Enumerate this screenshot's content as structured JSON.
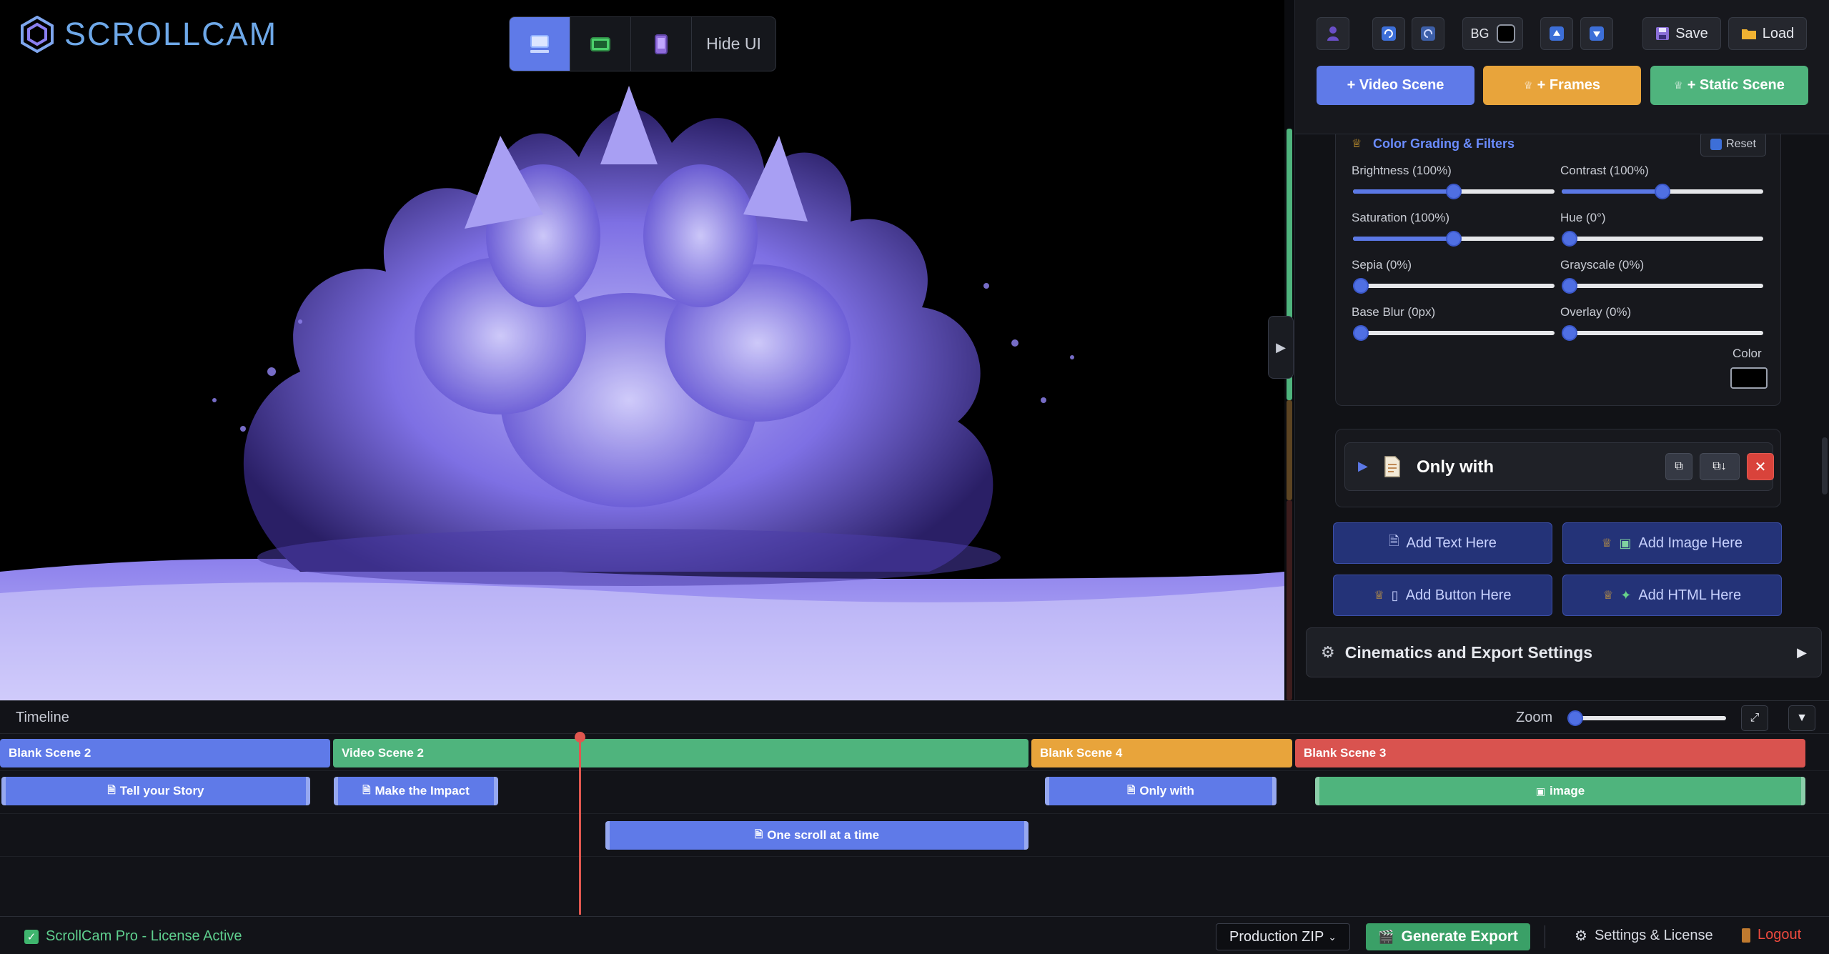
{
  "app": {
    "logo_text": "SCROLLCAM",
    "logo_color": "#6ea8e8"
  },
  "device_bar": {
    "devices": [
      {
        "name": "desktop",
        "icon": "monitor-icon",
        "active": true
      },
      {
        "name": "tablet",
        "icon": "tablet-landscape-icon",
        "active": false
      },
      {
        "name": "mobile",
        "icon": "mobile-phone-icon",
        "active": false
      }
    ],
    "hide_ui_label": "Hide UI"
  },
  "toolbar": {
    "bg_label": "BG",
    "bg_color": "#000000",
    "save_label": "Save",
    "load_label": "Load",
    "icons": [
      "user-silhouette-icon",
      "redo-icon",
      "undo-icon",
      "move-up-icon",
      "move-down-icon",
      "floppy-disk-icon",
      "folder-icon"
    ]
  },
  "scene_buttons": {
    "video": "+ Video Scene",
    "frames": "+ Frames",
    "static": "+ Static Scene",
    "colors": {
      "video": "#5f7ae8",
      "frames": "#e8a43b",
      "static": "#4fb47d"
    }
  },
  "color_grading": {
    "title": "Color Grading & Filters",
    "reset_label": "Reset",
    "sliders": [
      {
        "label": "Brightness (100%)",
        "value": 0.5
      },
      {
        "label": "Contrast (100%)",
        "value": 0.5
      },
      {
        "label": "Saturation (100%)",
        "value": 0.5
      },
      {
        "label": "Hue (0°)",
        "value": 0
      },
      {
        "label": "Sepia (0%)",
        "value": 0
      },
      {
        "label": "Grayscale (0%)",
        "value": 0
      },
      {
        "label": "Base Blur (0px)",
        "value": 0
      },
      {
        "label": "Overlay (0%)",
        "value": 0
      }
    ],
    "color_label": "Color",
    "overlay_color": "#000000"
  },
  "layer_item": {
    "title": "Only with",
    "icon": "document-icon",
    "actions": [
      "duplicate-icon",
      "duplicate-down-icon",
      "close-icon"
    ]
  },
  "add_buttons": [
    {
      "label": "Add Text Here",
      "icon": "document-icon",
      "pro": false
    },
    {
      "label": "Add Image Here",
      "icon": "image-icon",
      "pro": true
    },
    {
      "label": "Add Button Here",
      "icon": "phone-icon",
      "pro": true
    },
    {
      "label": "Add HTML Here",
      "icon": "puzzle-icon",
      "pro": true
    }
  ],
  "cinematics": {
    "label": "Cinematics and Export Settings"
  },
  "timeline": {
    "title": "Timeline",
    "zoom_label": "Zoom",
    "zoom_value": 0,
    "scenes": [
      {
        "label": "Blank Scene 2",
        "color": "#5f7ae8"
      },
      {
        "label": "Video Scene 2",
        "color": "#4fb47d"
      },
      {
        "label": "Blank Scene 4",
        "color": "#e8a43b"
      },
      {
        "label": "Blank Scene 3",
        "color": "#d9534f"
      }
    ],
    "layers": [
      {
        "label": "Tell your Story",
        "icon": "document-icon",
        "color": "#5f7ae8"
      },
      {
        "label": "Make the Impact",
        "icon": "document-icon",
        "color": "#5f7ae8"
      },
      {
        "label": "Only with",
        "icon": "document-icon",
        "color": "#5f7ae8"
      },
      {
        "label": "image",
        "icon": "image-icon",
        "color": "#4fb47d"
      },
      {
        "label": "One scroll at a time",
        "icon": "document-icon",
        "color": "#5f7ae8"
      }
    ]
  },
  "status": {
    "license": "ScrollCam Pro - License Active",
    "export_format": "Production ZIP",
    "generate_label": "Generate Export",
    "settings_label": "Settings & License",
    "logout_label": "Logout",
    "accent": "#3aa067",
    "logout_color": "#ee4a3e"
  }
}
